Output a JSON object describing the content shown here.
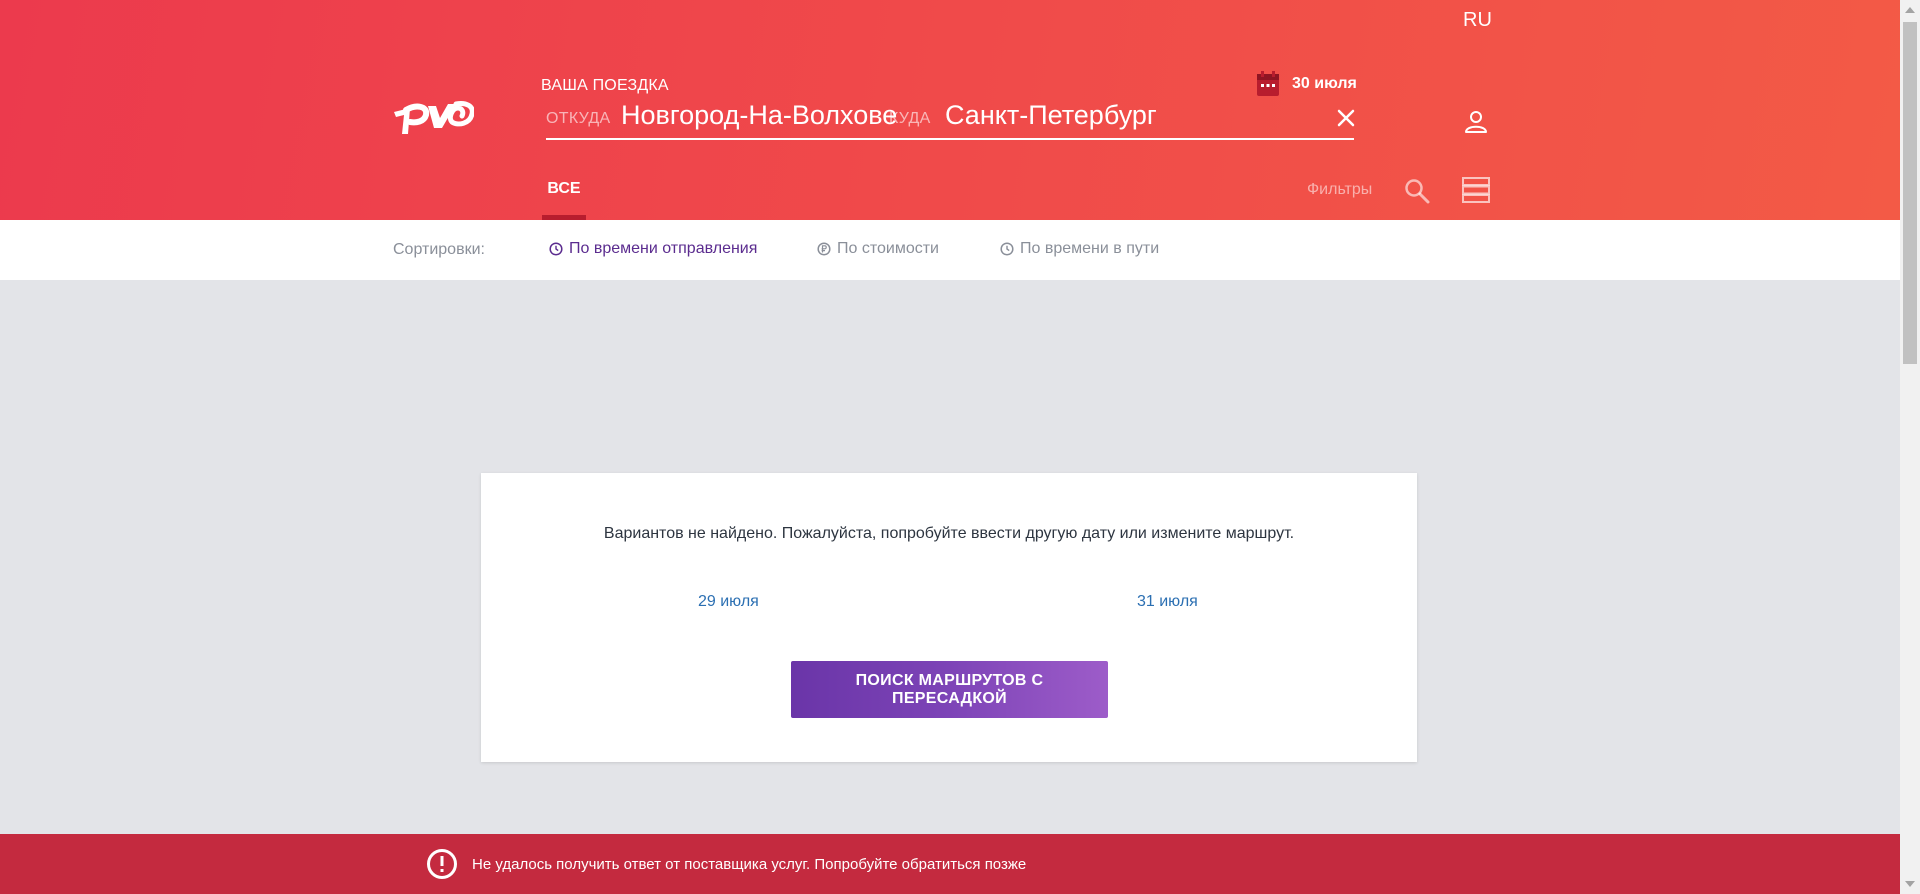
{
  "header": {
    "language": "RU",
    "trip_label": "ВАША ПОЕЗДКА",
    "date": "30 июля",
    "from_label": "ОТКУДА",
    "from_value": "Новгород-На-Волхове",
    "to_label": "КУДА",
    "to_value": "Санкт-Петербург",
    "tab_all": "ВСЕ",
    "filters_label": "Фильтры"
  },
  "sort": {
    "label": "Сортировки:",
    "options": [
      "По времени отправления",
      "По стоимости",
      "По времени в пути"
    ]
  },
  "results": {
    "message": "Вариантов не найдено. Пожалуйста, попробуйте ввести другую дату или измените маршрут.",
    "prev_date": "29 июля",
    "next_date": "31 июля",
    "transfer_button": "ПОИСК МАРШРУТОВ С ПЕРЕСАДКОЙ"
  },
  "error": {
    "message": "Не удалось получить ответ от поставщика услуг. Попробуйте обратиться позже"
  },
  "colors": {
    "header_start": "#ec3a4d",
    "header_end": "#f35a46",
    "accent_purple": "#5b2c8f",
    "link_blue": "#2b6fb2",
    "error_bar": "#c42a3f"
  }
}
